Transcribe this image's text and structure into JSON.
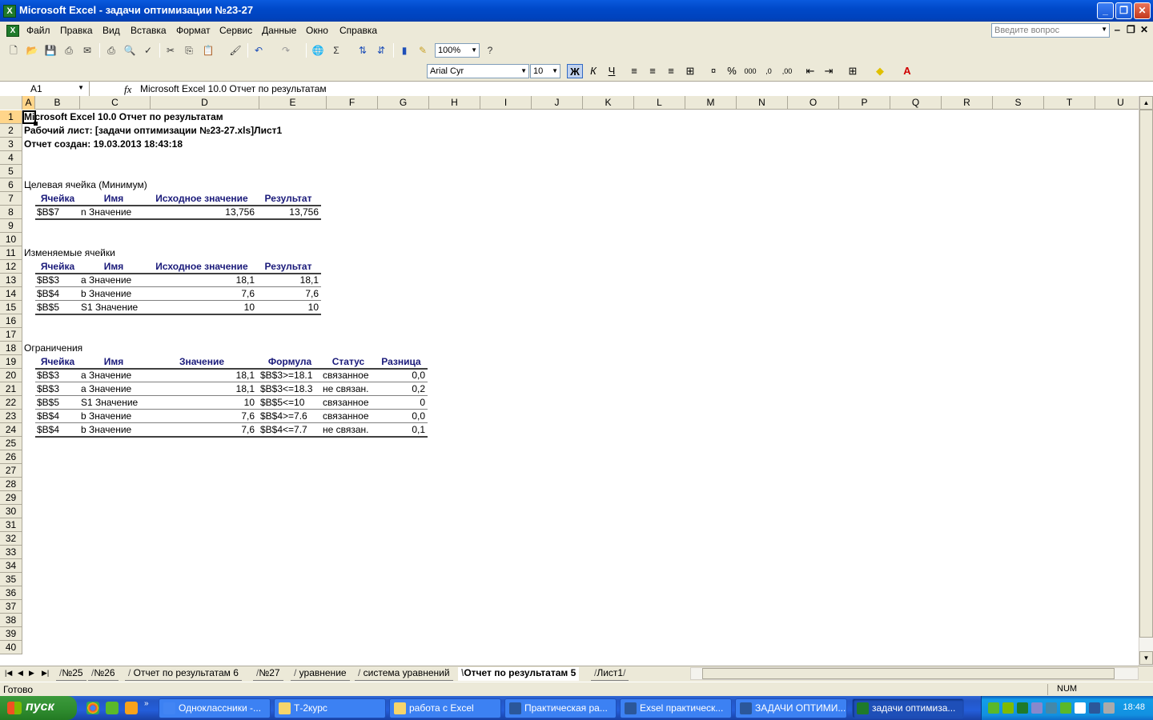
{
  "window": {
    "title": "Microsoft Excel - задачи оптимизации №23-27",
    "app_icon": "X",
    "minimize": "_",
    "maximize": "❐",
    "close": "✕"
  },
  "menu": {
    "items": [
      "Файл",
      "Правка",
      "Вид",
      "Вставка",
      "Формат",
      "Сервис",
      "Данные",
      "Окно",
      "Справка"
    ],
    "help_placeholder": "Введите вопрос"
  },
  "toolbar": {
    "zoom": "100%",
    "font_name": "Arial Cyr",
    "font_size": "10",
    "bold": "Ж",
    "italic": "К",
    "underline": "Ч"
  },
  "formula_bar": {
    "name_box": "A1",
    "fx": "fx",
    "content": "Microsoft Excel 10.0 Отчет по результатам"
  },
  "columns": [
    "A",
    "B",
    "C",
    "D",
    "E",
    "F",
    "G",
    "H",
    "I",
    "J",
    "K",
    "L",
    "M",
    "N",
    "O",
    "P",
    "Q",
    "R",
    "S",
    "T",
    "U"
  ],
  "rows": [
    "1",
    "2",
    "3",
    "4",
    "5",
    "6",
    "7",
    "8",
    "9",
    "10",
    "11",
    "12",
    "13",
    "14",
    "15",
    "16",
    "17",
    "18",
    "19",
    "20",
    "21",
    "22",
    "23",
    "24",
    "25",
    "26",
    "27",
    "28",
    "29",
    "30",
    "31",
    "32",
    "33",
    "34",
    "35",
    "36",
    "37",
    "38",
    "39",
    "40"
  ],
  "report": {
    "line1": "Microsoft Excel 10.0 Отчет по результатам",
    "line2": "Рабочий лист: [задачи оптимизации №23-27.xls]Лист1",
    "line3": "Отчет создан: 19.03.2013 18:43:18",
    "target": {
      "title": "Целевая ячейка (Минимум)",
      "headers": [
        "Ячейка",
        "Имя",
        "Исходное значение",
        "Результат"
      ],
      "rows": [
        [
          "$B$7",
          "n Значение",
          "13,756",
          "13,756"
        ]
      ]
    },
    "changing": {
      "title": "Изменяемые ячейки",
      "headers": [
        "Ячейка",
        "Имя",
        "Исходное значение",
        "Результат"
      ],
      "rows": [
        [
          "$B$3",
          "a Значение",
          "18,1",
          "18,1"
        ],
        [
          "$B$4",
          "b Значение",
          "7,6",
          "7,6"
        ],
        [
          "$B$5",
          "S1 Значение",
          "10",
          "10"
        ]
      ]
    },
    "constraints": {
      "title": "Ограничения",
      "headers": [
        "Ячейка",
        "Имя",
        "Значение",
        "Формула",
        "Статус",
        "Разница"
      ],
      "rows": [
        [
          "$B$3",
          "a Значение",
          "18,1",
          "$B$3>=18.1",
          "связанное",
          "0,0"
        ],
        [
          "$B$3",
          "a Значение",
          "18,1",
          "$B$3<=18.3",
          "не связан.",
          "0,2"
        ],
        [
          "$B$5",
          "S1 Значение",
          "10",
          "$B$5<=10",
          "связанное",
          "0"
        ],
        [
          "$B$4",
          "b Значение",
          "7,6",
          "$B$4>=7.6",
          "связанное",
          "0,0"
        ],
        [
          "$B$4",
          "b Значение",
          "7,6",
          "$B$4<=7.7",
          "не связан.",
          "0,1"
        ]
      ]
    }
  },
  "sheet_tabs": {
    "tabs": [
      "№25",
      "№26",
      "Отчет по результатам 6",
      "№27",
      "уравнение",
      "система уравнений",
      "Отчет по результатам 5",
      "Лист1"
    ],
    "active_index": 6
  },
  "status": {
    "ready": "Готово",
    "num": "NUM"
  },
  "taskbar": {
    "start": "пуск",
    "buttons": [
      "Одноклассники -...",
      "Т-2курс",
      "работа с Excel",
      "Практическая ра...",
      "Exsel практическ...",
      "ЗАДАЧИ ОПТИМИ...",
      "задачи оптимиза..."
    ],
    "active_index": 6,
    "clock": "18:48"
  }
}
